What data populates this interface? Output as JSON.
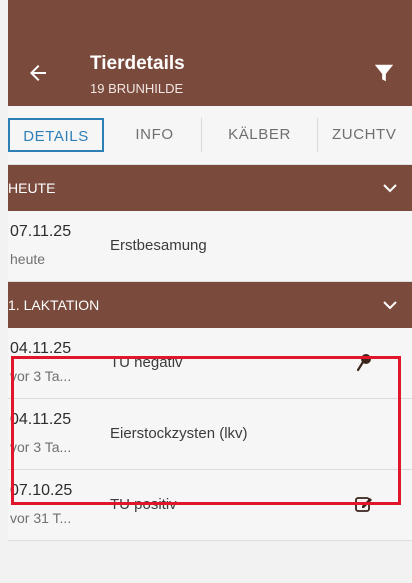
{
  "header": {
    "title": "Tierdetails",
    "subtitle": "19 BRUNHILDE"
  },
  "tabs": [
    {
      "label": "DETAILS",
      "active": true
    },
    {
      "label": "INFO",
      "active": false
    },
    {
      "label": "KÄLBER",
      "active": false
    },
    {
      "label": "ZUCHTV",
      "active": false
    }
  ],
  "sections": [
    {
      "label": "HEUTE",
      "rows": [
        {
          "date": "07.11.25",
          "ago": "heute",
          "description": "Erstbesamung",
          "icon": ""
        }
      ]
    },
    {
      "label": "1. LAKTATION",
      "rows": [
        {
          "date": "04.11.25",
          "ago": "vor 3 Ta...",
          "description": "TU negativ",
          "icon": "pin-icon"
        },
        {
          "date": "04.11.25",
          "ago": "vor 3 Ta...",
          "description": "Eierstockzysten (lkv)",
          "icon": ""
        },
        {
          "date": "07.10.25",
          "ago": "vor 31 T...",
          "description": "TU positiv",
          "icon": "edit-icon"
        }
      ]
    }
  ],
  "colors": {
    "primary": "#7a4b3c",
    "tab_active": "#2e7fb6",
    "highlight": "#e2162a"
  }
}
